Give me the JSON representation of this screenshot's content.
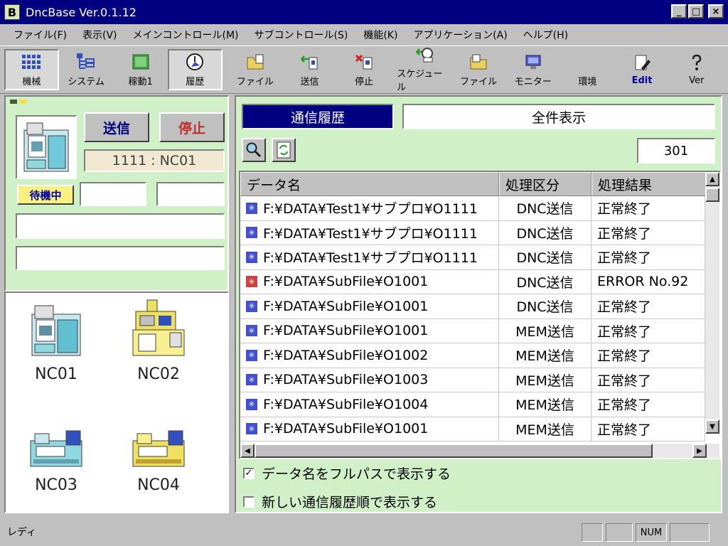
{
  "window": {
    "title": "DncBase  Ver.0.1.12",
    "app_icon": "B",
    "min": "_",
    "max": "□",
    "close": "×"
  },
  "menu": [
    "ファイル(F)",
    "表示(V)",
    "メインコントロール(M)",
    "サブコントロール(S)",
    "機能(K)",
    "アプリケーション(A)",
    "ヘルプ(H)"
  ],
  "toolbar": {
    "machine": "機械",
    "system": "システム",
    "operation": "稼動1",
    "history": "履歴",
    "file": "ファイル",
    "send": "送信",
    "stop": "停止",
    "schedule": "スケジュール",
    "file2": "ファイル",
    "monitor": "モニター",
    "env": "環境",
    "edit": "Edit",
    "ver": "Ver"
  },
  "left": {
    "send_btn": "送信",
    "stop_btn": "停止",
    "machine_id": "1111 : NC01",
    "status": "待機中",
    "machines": [
      "NC01",
      "NC02",
      "NC03",
      "NC04"
    ]
  },
  "right": {
    "title": "通信履歴",
    "filter": "全件表示",
    "count": "301",
    "columns": [
      "データ名",
      "処理区分",
      "処理結果"
    ],
    "rows": [
      [
        "F:¥DATA¥Test1¥サブプロ¥O1111",
        "DNC送信",
        "正常終了"
      ],
      [
        "F:¥DATA¥Test1¥サブプロ¥O1111",
        "DNC送信",
        "正常終了"
      ],
      [
        "F:¥DATA¥Test1¥サブプロ¥O1111",
        "DNC送信",
        "正常終了"
      ],
      [
        "F:¥DATA¥SubFile¥O1001",
        "DNC送信",
        "ERROR No.92"
      ],
      [
        "F:¥DATA¥SubFile¥O1001",
        "DNC送信",
        "正常終了"
      ],
      [
        "F:¥DATA¥SubFile¥O1001",
        "MEM送信",
        "正常終了"
      ],
      [
        "F:¥DATA¥SubFile¥O1002",
        "MEM送信",
        "正常終了"
      ],
      [
        "F:¥DATA¥SubFile¥O1003",
        "MEM送信",
        "正常終了"
      ],
      [
        "F:¥DATA¥SubFile¥O1004",
        "MEM送信",
        "正常終了"
      ],
      [
        "F:¥DATA¥SubFile¥O1001",
        "MEM送信",
        "正常終了"
      ]
    ],
    "row_status": [
      "ok",
      "ok",
      "ok",
      "err",
      "ok",
      "ok",
      "ok",
      "ok",
      "ok",
      "ok"
    ],
    "chk_fullpath": "データ名をフルパスで表示する",
    "chk_neworder": "新しい通信履歴順で表示する"
  },
  "statusbar": {
    "text": "レディ",
    "num": "NUM"
  },
  "colors": {
    "panel_green": "#d0f0c8",
    "title_blue": "#000080",
    "ok_icon": "#4050d0",
    "err_icon": "#d04040"
  }
}
